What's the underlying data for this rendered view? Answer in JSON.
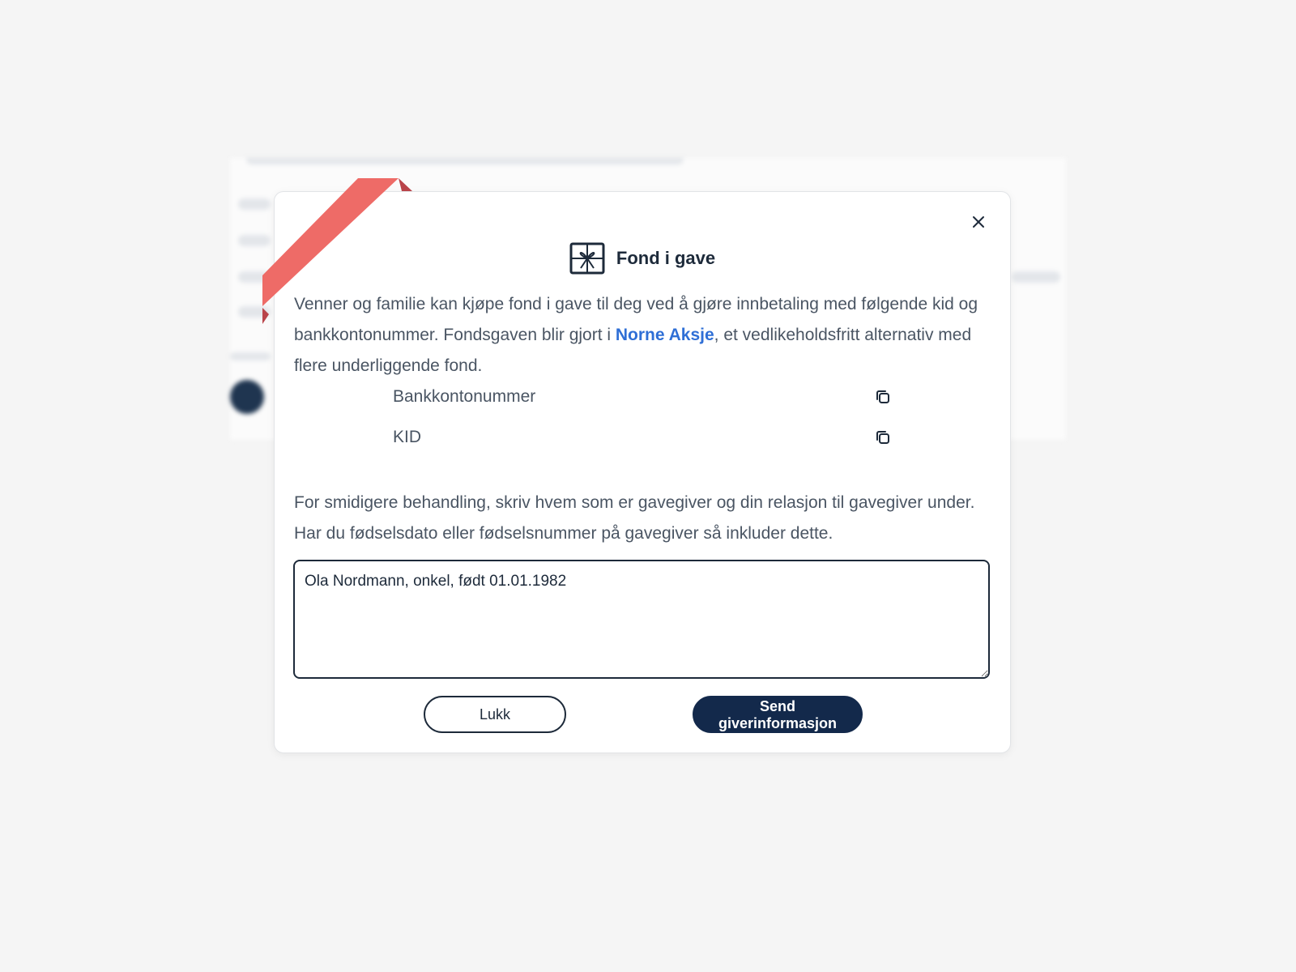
{
  "colors": {
    "page_background": "#f5f5f5",
    "text_dark": "#1d2a3a",
    "text_body": "#4a5563",
    "link": "#2f6fd6",
    "primary_button": "#13294b",
    "ribbon": "#ee6b67",
    "ribbon_shadow": "#b9444a"
  },
  "modal": {
    "title": "Fond i gave",
    "title_icon": "gift-box-icon",
    "close_icon": "close-icon",
    "intro": {
      "before_link": "Venner og familie kan kjøpe fond i gave til deg ved å gjøre innbetaling med følgende kid og bankkontonummer. Fondsgaven blir gjort i ",
      "link_text": "Norne Aksje",
      "after_link": ", et vedlikeholdsfritt alternativ med flere underliggende fond."
    },
    "fields": [
      {
        "label": "Bankkontonummer",
        "icon": "copy-icon"
      },
      {
        "label": "KID",
        "icon": "copy-icon"
      }
    ],
    "info_text": "For smidigere behandling, skriv hvem som er gavegiver og din relasjon til gavegiver under. Har du fødselsdato eller fødselsnummer på gavegiver så inkluder dette.",
    "giver_input_value": "Ola Nordmann, onkel, født 01.01.1982",
    "buttons": {
      "close_label": "Lukk",
      "send_label": "Send giverinformasjon"
    }
  }
}
